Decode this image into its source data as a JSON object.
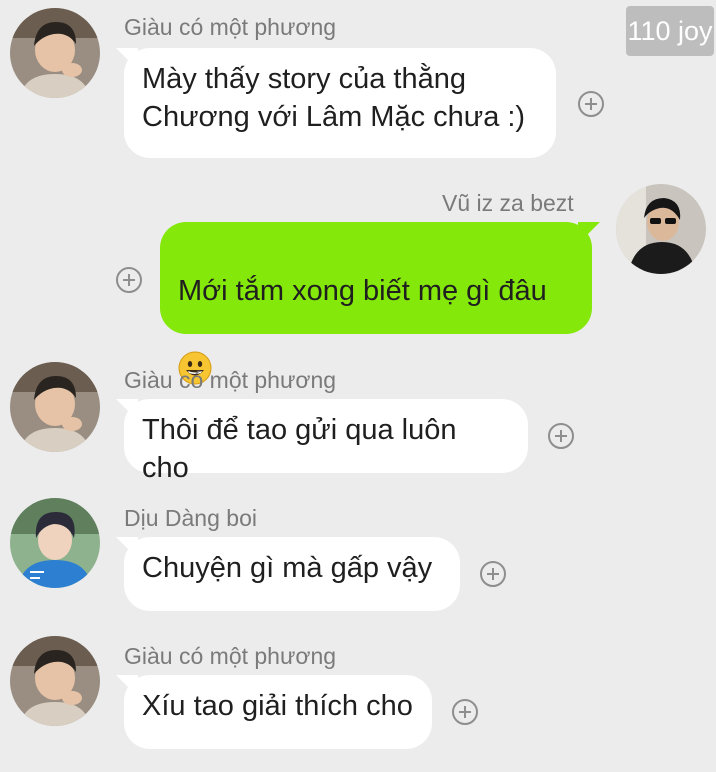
{
  "watermark": "110 joy",
  "messages": [
    {
      "sender": "Giàu có một phương",
      "text": "Mày thấy story của thằng\nChương với Lâm Mặc chưa :)",
      "avatar_icon": "boy-chin-on-hand-avatar"
    },
    {
      "sender": "Vũ iz za bezt",
      "text": "Mới tắm xong biết mẹ gì đâu",
      "emoji": "grinning-face-emoji",
      "avatar_icon": "boy-sunglasses-avatar"
    },
    {
      "sender": "Giàu có một phương",
      "text": "Thôi để tao gửi qua luôn cho",
      "avatar_icon": "boy-chin-on-hand-avatar"
    },
    {
      "sender": "Dịu Dàng boi",
      "text": "Chuyện gì mà gấp vậy",
      "avatar_icon": "boy-blue-shirt-avatar"
    },
    {
      "sender": "Giàu có một phương",
      "text": "Xíu tao giải thích cho",
      "avatar_icon": "boy-chin-on-hand-avatar"
    }
  ],
  "colors": {
    "background": "#ececec",
    "incoming_bubble": "#ffffff",
    "outgoing_bubble": "#85e80b",
    "name_text": "#7a7a7a"
  }
}
